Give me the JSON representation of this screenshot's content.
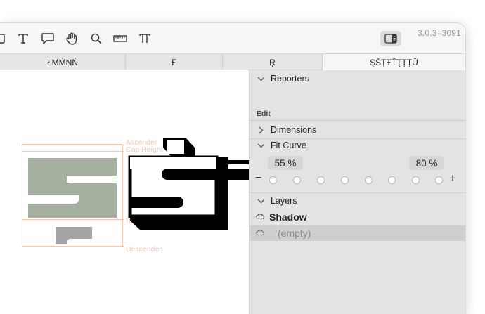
{
  "version": "3.0.3–3091",
  "toolbar": {
    "tools": [
      "partial-node-icon",
      "text-tool-icon",
      "comment-icon",
      "hand-icon",
      "zoom-icon",
      "ruler-icon",
      "typewriter-icon"
    ],
    "sidebar_toggle": "sidebar-toggle-icon"
  },
  "tabs": [
    {
      "label": "ŁMṀNŃ"
    },
    {
      "label": "Ғ"
    },
    {
      "label": "Ŗ"
    },
    {
      "label": "ŞŠŢŦŤŢȚṬŪ"
    }
  ],
  "canvas": {
    "metric_labels": {
      "ascender": "Ascender",
      "cap_height": "Cap Height",
      "baseline": "Baseline",
      "descender": "Descender"
    }
  },
  "panel": {
    "reporters": {
      "title": "Reporters",
      "edit": "Edit"
    },
    "dimensions": {
      "title": "Dimensions"
    },
    "fit_curve": {
      "title": "Fit Curve",
      "left_value": "55 %",
      "right_value": "80 %",
      "minus": "−",
      "plus": "+",
      "dots": 8
    },
    "layers": {
      "title": "Layers",
      "items": [
        {
          "name": "Shadow",
          "selected": false
        },
        {
          "name": "(empty)",
          "selected": true
        }
      ]
    }
  },
  "colors": {
    "accent_gray": "#a5b0a0",
    "metric_line": "#f1c7b3",
    "selection": "#cfcfcf"
  }
}
